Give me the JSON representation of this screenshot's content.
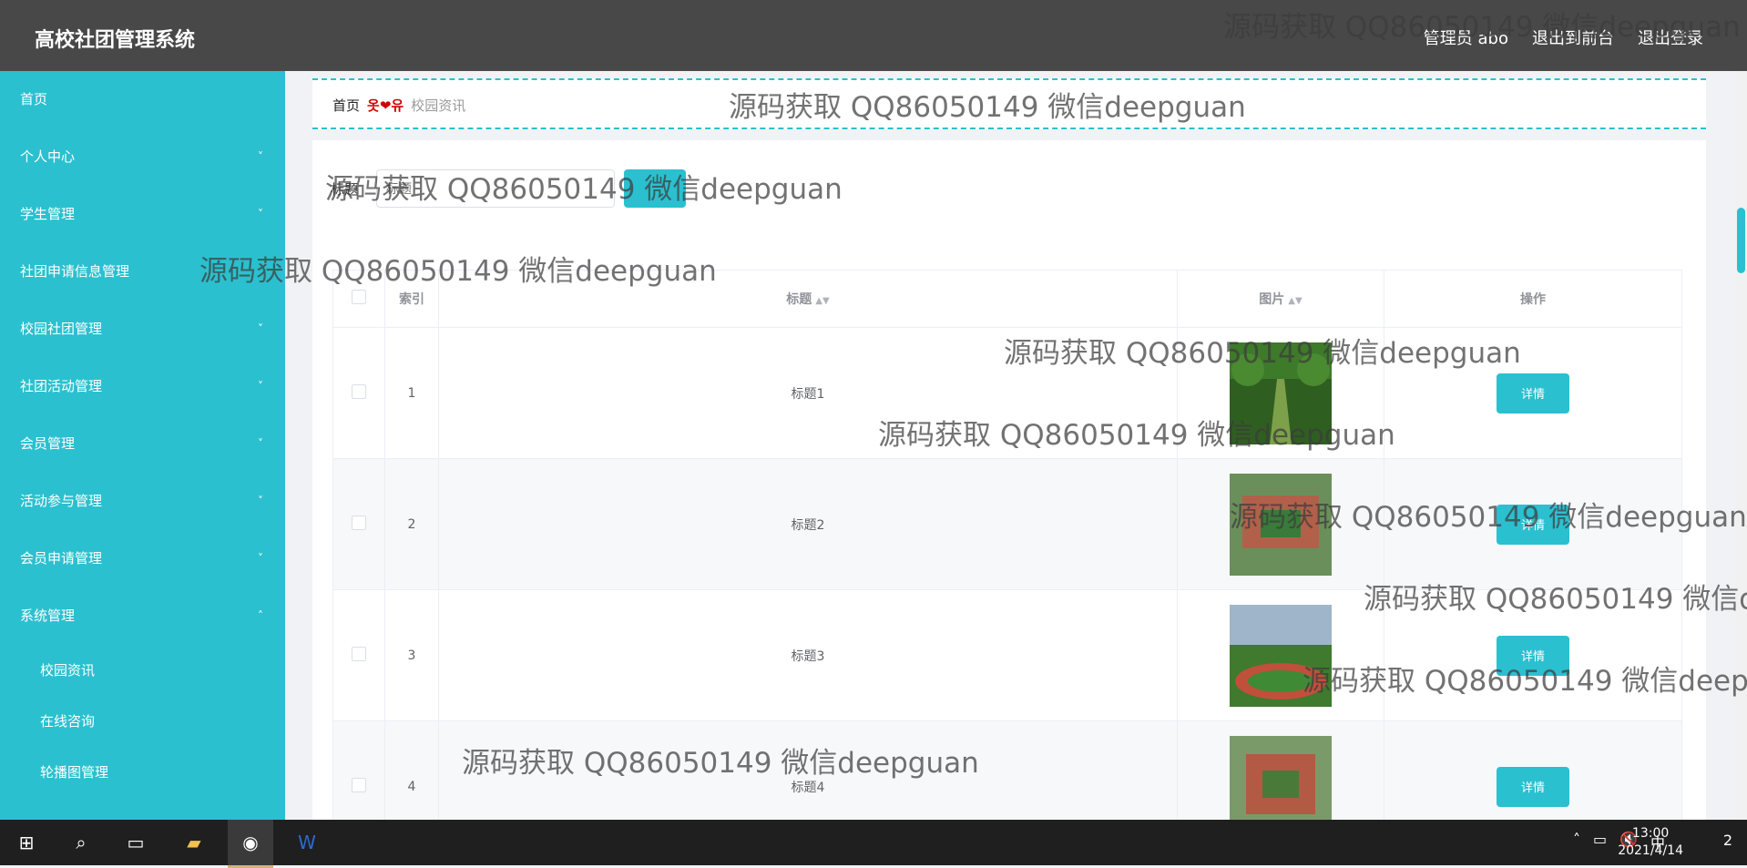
{
  "header": {
    "title": "高校社团管理系统",
    "admin": "管理员 abo",
    "back_front": "退出到前台",
    "logout": "退出登录"
  },
  "sidebar": {
    "items": [
      {
        "label": "首页",
        "chevron": ""
      },
      {
        "label": "个人中心",
        "chevron": "˅"
      },
      {
        "label": "学生管理",
        "chevron": "˅"
      },
      {
        "label": "社团申请信息管理",
        "chevron": ""
      },
      {
        "label": "校园社团管理",
        "chevron": "˅"
      },
      {
        "label": "社团活动管理",
        "chevron": "˅"
      },
      {
        "label": "会员管理",
        "chevron": "˅"
      },
      {
        "label": "活动参与管理",
        "chevron": "˅"
      },
      {
        "label": "会员申请管理",
        "chevron": "˅"
      },
      {
        "label": "系统管理",
        "chevron": "˄"
      }
    ],
    "subitems": [
      "校园资讯",
      "在线咨询",
      "轮播图管理"
    ]
  },
  "breadcrumb": {
    "home": "首页",
    "sep": "옷❤유",
    "current": "校园资讯"
  },
  "search": {
    "label": "标题",
    "placeholder": "标题",
    "button_label": "查询"
  },
  "table": {
    "headers": [
      "索引",
      "标题",
      "图片",
      "操作"
    ],
    "rows": [
      {
        "index": "1",
        "title": "标题1",
        "action": "详情"
      },
      {
        "index": "2",
        "title": "标题2",
        "action": "详情"
      },
      {
        "index": "3",
        "title": "标题3",
        "action": "详情"
      },
      {
        "index": "4",
        "title": "标题4",
        "action": "详情"
      }
    ]
  },
  "watermark_text": "源码获取 QQ86050149 微信deepguan",
  "taskbar": {
    "time": "13:00",
    "date": "2021/4/14",
    "ime": "中",
    "notify_count": "2"
  }
}
